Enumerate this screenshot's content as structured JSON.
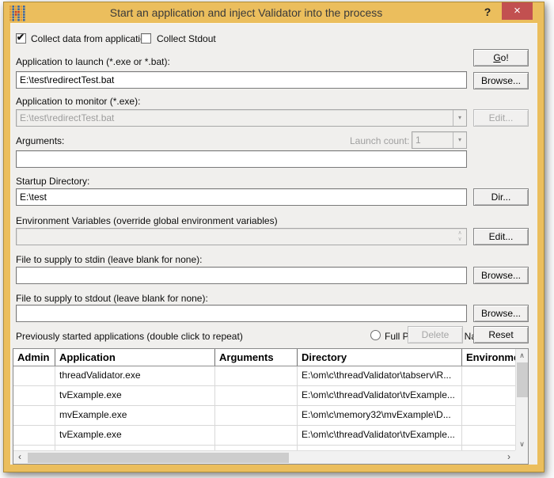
{
  "window": {
    "title": "Start an application and inject Validator into the process",
    "help_label": "?",
    "close_label": "×"
  },
  "colors": {
    "titlebar": "#ebbe5d",
    "close_button": "#c25050",
    "dialog_bg": "#f0efed",
    "icon_orange": "#de9a38",
    "icon_blue": "#3b69a5",
    "icon_red": "#c43b2a"
  },
  "icons": {
    "check": "✔",
    "dropdown": "▾",
    "spin_up": "∧",
    "spin_down": "∨",
    "scroll_up": "∧",
    "scroll_down": "∨",
    "scroll_left": "‹",
    "scroll_right": "›"
  },
  "checkboxes": {
    "collect_data": {
      "label": "Collect data from application",
      "checked": true
    },
    "collect_stdout": {
      "label": "Collect Stdout",
      "checked": false
    }
  },
  "fields": {
    "launch": {
      "label": "Application to launch (*.exe or *.bat):",
      "value": "E:\\test\\redirectTest.bat"
    },
    "monitor": {
      "label": "Application to monitor (*.exe):",
      "value": "E:\\test\\redirectTest.bat",
      "disabled": true
    },
    "arguments": {
      "label": "Arguments:",
      "value": ""
    },
    "launch_count": {
      "label": "Launch count:",
      "value": "1",
      "disabled": true
    },
    "startup_dir": {
      "label": "Startup Directory:",
      "value": "E:\\test"
    },
    "env_vars": {
      "label": "Environment Variables (override global environment variables)",
      "value": "",
      "disabled": true
    },
    "stdin": {
      "label": "File to supply to stdin (leave blank for none):",
      "value": ""
    },
    "stdout": {
      "label": "File to supply to stdout (leave blank for none):",
      "value": ""
    }
  },
  "buttons": {
    "go": "Go!",
    "browse": "Browse...",
    "edit": "Edit...",
    "dir": "Dir...",
    "delete": "Delete",
    "reset": "Reset"
  },
  "history": {
    "label": "Previously started applications (double click to repeat)",
    "radio_full_path": "Full Path",
    "radio_image_name": "Image Name",
    "selected": "Image Name"
  },
  "table": {
    "columns": [
      "Admin",
      "Application",
      "Arguments",
      "Directory",
      "Environment"
    ],
    "rows": [
      {
        "admin": "",
        "application": "threadValidator.exe",
        "arguments": "",
        "directory": "E:\\om\\c\\threadValidator\\tabserv\\R...",
        "environment": ""
      },
      {
        "admin": "",
        "application": "tvExample.exe",
        "arguments": "",
        "directory": "E:\\om\\c\\threadValidator\\tvExample...",
        "environment": ""
      },
      {
        "admin": "",
        "application": "mvExample.exe",
        "arguments": "",
        "directory": "E:\\om\\c\\memory32\\mvExample\\D...",
        "environment": ""
      },
      {
        "admin": "",
        "application": "tvExample.exe",
        "arguments": "",
        "directory": "E:\\om\\c\\threadValidator\\tvExample...",
        "environment": ""
      }
    ]
  }
}
